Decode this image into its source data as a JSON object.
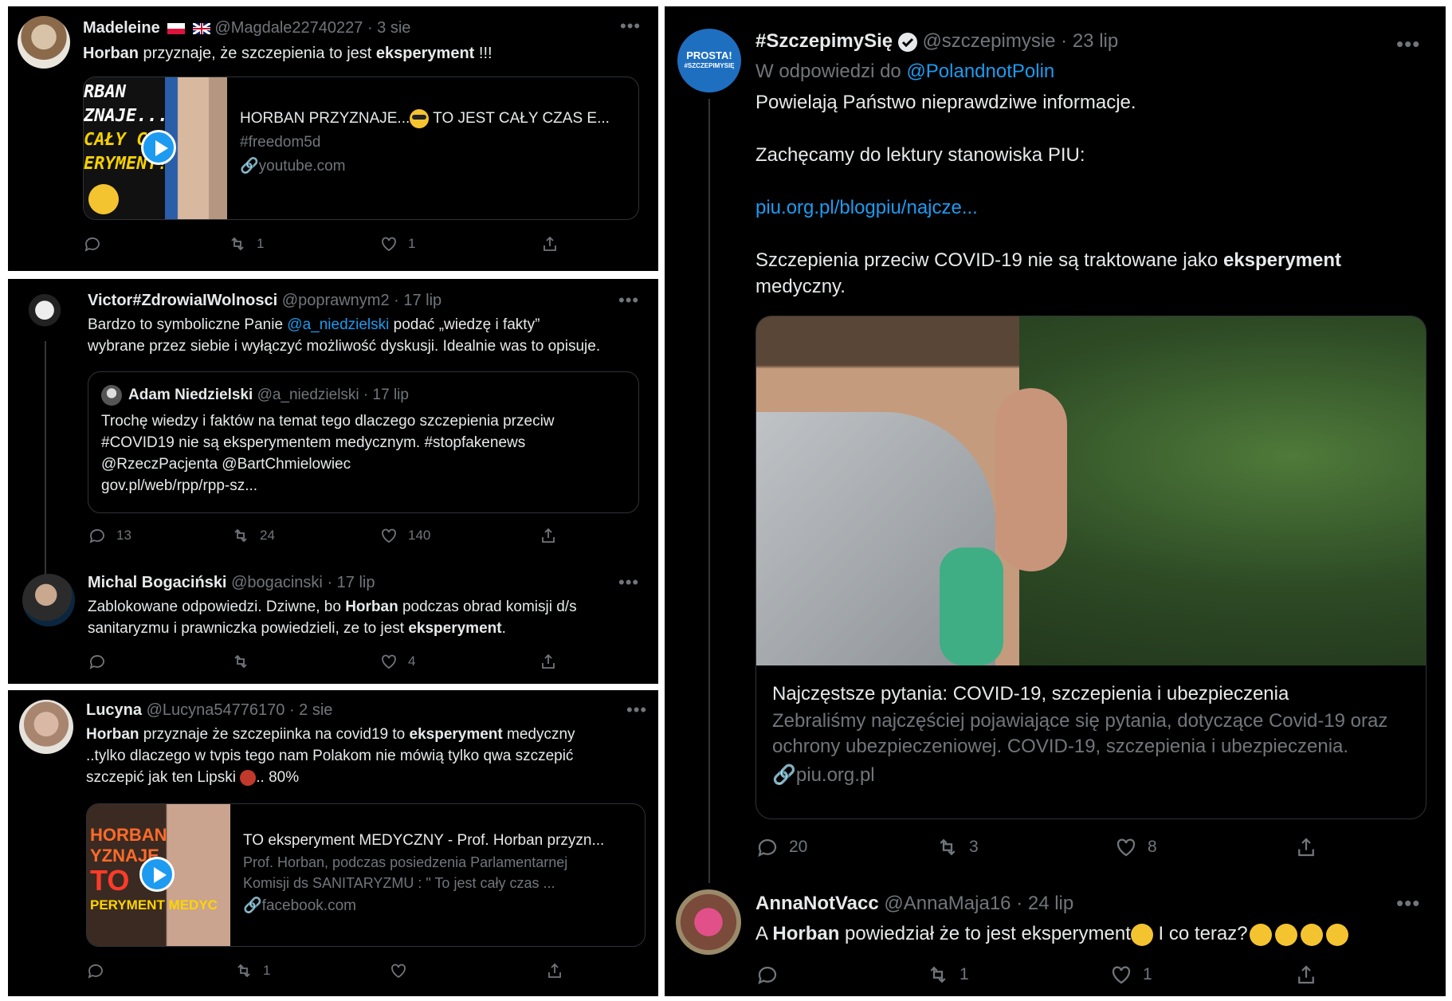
{
  "t1": {
    "name": "Madeleine",
    "handle": "@Magdale22740227",
    "time": "· 3 sie",
    "text_b1": "Horban",
    "text_1": " przyznaje, że szczepienia  to jest ",
    "text_b2": "eksperyment",
    "text_2": " !!!",
    "card_title": "HORBAN PRZYZNAJE...",
    "card_title_2": " TO JEST CAŁY CZAS E...",
    "card_desc": "#freedom5d",
    "card_domain": "youtube.com",
    "thumb_lines": [
      "RBAN",
      "ZNAJE...",
      "CAŁY CZ",
      "ERYMENT!"
    ],
    "retweets": "1",
    "likes": "1"
  },
  "t2": {
    "name": "Victor#ZdrowiaIWolnosci",
    "handle": "@poprawnym2",
    "time": "· 17 lip",
    "text_1": "Bardzo to symboliczne Panie ",
    "mention": "@a_niedzielski",
    "text_2": " podać „wiedzę i fakty”",
    "text_3": "wybrane przez siebie i wyłączyć możliwość dyskusji. Idealnie was to opisuje.",
    "quote_name": "Adam Niedzielski",
    "quote_handle": "@a_niedzielski",
    "quote_time": "· 17 lip",
    "quote_lines": [
      "Trochę wiedzy i faktów na temat tego dlaczego szczepienia przeciw",
      "#COVID19 nie są eksperymentem medycznym. #stopfakenews",
      "@RzeczPacjenta @BartChmielowiec",
      "gov.pl/web/rpp/rpp-sz..."
    ],
    "replies": "13",
    "retweets": "24",
    "likes": "140"
  },
  "t3": {
    "name": "Michal Bogaciński",
    "handle": "@bogacinski",
    "time": "· 17 lip",
    "text_1": "Zablokowane odpowiedzi. Dziwne, bo ",
    "text_b1": "Horban",
    "text_2": " podczas obrad komisji d/s",
    "text_3": "sanitaryzmu i prawniczka powiedzieli, ze to jest ",
    "text_b2": "eksperyment",
    "text_4": ".",
    "likes": "4"
  },
  "t4": {
    "name": "Lucyna",
    "handle": "@Lucyna54776170",
    "time": "· 2 sie",
    "text_b1": "Horban",
    "text_1": " przyznaje że szczepiinka na covid19 to ",
    "text_b2": "eksperyment",
    "text_2": " medyczny",
    "text_3": "..tylko dlaczego w tvpis tego nam Polakom nie mówią tylko qwa szczepić",
    "text_4": "szczepić jak ten Lipski",
    "text_5": ".. 80%",
    "card_title": "TO eksperyment MEDYCZNY - Prof. Horban przyzn...",
    "card_desc_1": "Prof. Horban, podczas posiedzenia Parlamentarnej",
    "card_desc_2": "Komisji ds SANITARYZMU : \" To jest cały czas ...",
    "card_domain": "facebook.com",
    "thumb_lines": [
      "HORBAN",
      "YZNAJE",
      "TO",
      "PERYMENT MEDYC"
    ],
    "retweets": "1"
  },
  "t5": {
    "name": "#SzczepimySię",
    "handle": "@szczepimysie",
    "time": "· 23 lip",
    "reply_to": "W odpowiedzi do ",
    "reply_handle": "@PolandnotPolin",
    "avatar_text_1": "PROSTA!",
    "avatar_text_2": "#SZCZEPIMYSIĘ",
    "line_1": "Powielają Państwo nieprawdziwe informacje.",
    "line_2": "Zachęcamy do lektury stanowiska PIU:",
    "link": "piu.org.pl/blogpiu/najcze...",
    "line_3a": "Szczepienia przeciw COVID-19 nie są traktowane jako ",
    "line_3b": "eksperyment",
    "line_3c": "medyczny.",
    "card_title": "Najczęstsze pytania: COVID-19, szczepienia i ubezpieczenia",
    "card_desc_1": "Zebraliśmy najczęściej pojawiające się pytania, dotyczące Covid-19 oraz",
    "card_desc_2": "ochrony ubezpieczeniowej. COVID-19, szczepienia i ubezpieczenia.",
    "card_domain": "piu.org.pl",
    "replies": "20",
    "retweets": "3",
    "likes": "8"
  },
  "t6": {
    "name": "AnnaNotVacc",
    "handle": "@AnnaMaja16",
    "time": "· 24 lip",
    "text_1": "A ",
    "text_b1": "Horban",
    "text_2": " powiedział że to jest eksperyment",
    "text_3": " I co teraz?",
    "retweets": "1",
    "likes": "1"
  },
  "colors": {
    "background": "#000000",
    "text": "#e7e9ea",
    "secondary": "#71767b",
    "link": "#1d9bf0",
    "border": "#2f3336"
  }
}
